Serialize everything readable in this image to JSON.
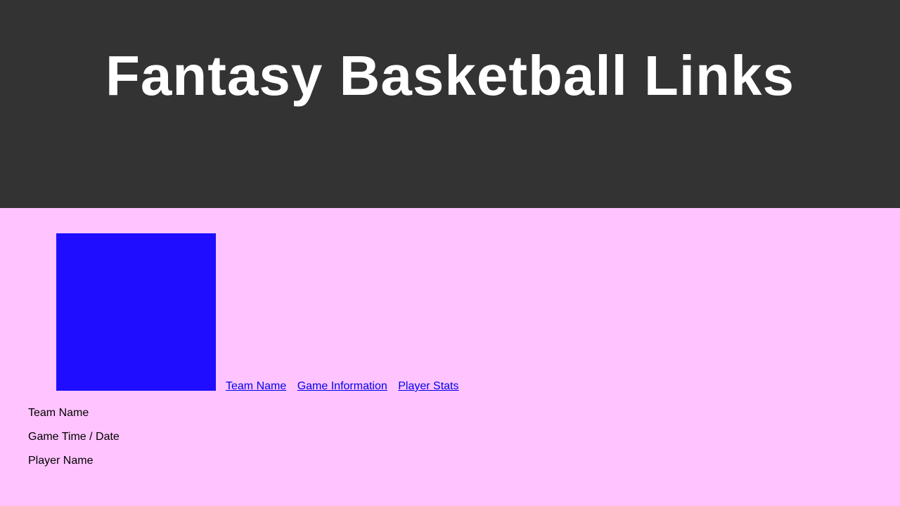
{
  "header": {
    "title": "Fantasy Basketball Links"
  },
  "colors": {
    "header_bg": "#333333",
    "page_bg": "#ffc4ff",
    "logo_box": "#1e0dff",
    "link": "#0000ee"
  },
  "nav": {
    "links": [
      {
        "label": "Team Name"
      },
      {
        "label": "Game Information"
      },
      {
        "label": "Player Stats"
      }
    ]
  },
  "info": {
    "team_name": "Team Name",
    "game_time": "Game Time / Date",
    "player_name": "Player Name"
  }
}
